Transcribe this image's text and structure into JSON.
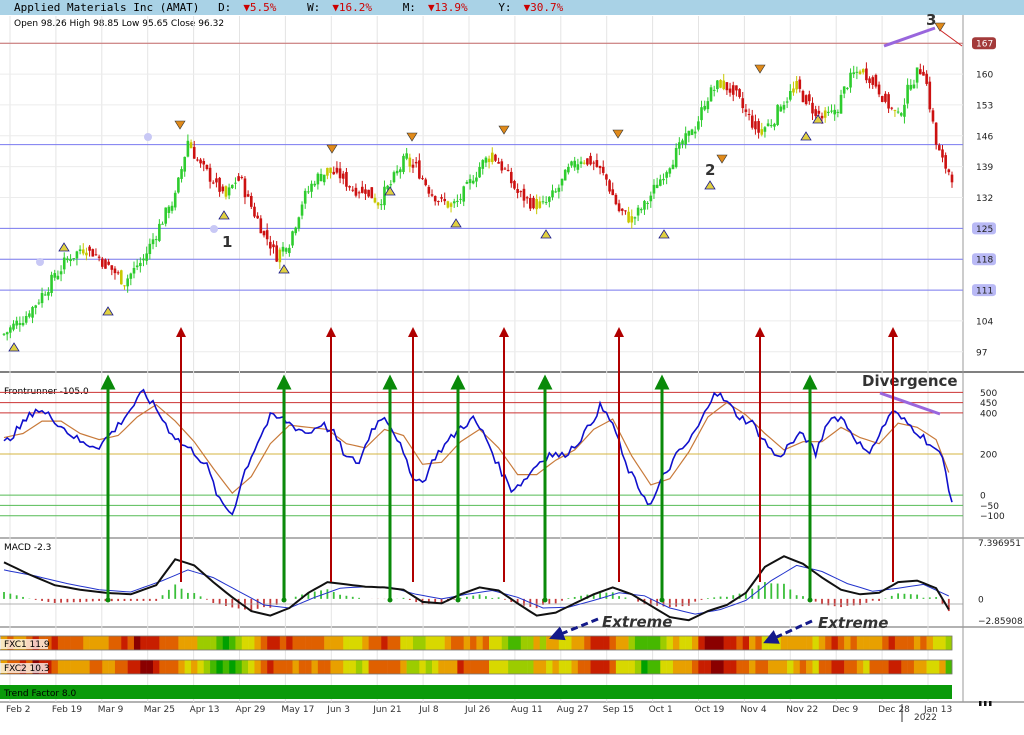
{
  "header": {
    "title": "Applied Materials Inc (AMAT)",
    "day_label": "D:",
    "day_value": "▼5.5%",
    "week_label": "W:",
    "week_value": "▼16.2%",
    "month_label": "M:",
    "month_value": "▼13.9%",
    "year_label": "Y:",
    "year_value": "▼30.7%",
    "ohlc": "Open 98.26  High 98.85  Low 95.65  Close 96.32"
  },
  "colors": {
    "up": "#2ecc2e",
    "down": "#cc1111",
    "neutral": "#c8c800",
    "hline": "#7a7af0",
    "frontrunner": "#1010cc",
    "signal": "#c87a3a",
    "green_arrow": "#0a8a0a",
    "red_arrow": "#b00000",
    "divergence": "#9966dd",
    "title_bg": "#a9d2e6"
  },
  "chart_data": {
    "type": "candlestick",
    "price_panel": {
      "y_ticks": [
        97,
        104,
        111,
        118,
        125,
        132,
        139,
        146,
        153,
        160,
        167
      ],
      "ylim": [
        94,
        170
      ],
      "highlighted_levels": [
        "111",
        "118",
        "125",
        "144",
        "167"
      ],
      "horizontal_levels": [
        111,
        118,
        125,
        144,
        167
      ],
      "wave_labels": [
        "1",
        "2",
        "3"
      ],
      "close_path": [
        [
          0,
          101
        ],
        [
          8,
          106
        ],
        [
          14,
          112
        ],
        [
          20,
          118
        ],
        [
          26,
          121
        ],
        [
          32,
          117
        ],
        [
          38,
          113
        ],
        [
          44,
          118
        ],
        [
          50,
          127
        ],
        [
          54,
          132
        ],
        [
          58,
          145
        ],
        [
          62,
          139
        ],
        [
          66,
          136
        ],
        [
          70,
          132
        ],
        [
          74,
          137
        ],
        [
          78,
          130
        ],
        [
          82,
          124
        ],
        [
          86,
          119
        ],
        [
          90,
          122
        ],
        [
          94,
          131
        ],
        [
          98,
          136
        ],
        [
          102,
          138
        ],
        [
          106,
          137
        ],
        [
          110,
          134
        ],
        [
          114,
          134
        ],
        [
          118,
          131
        ],
        [
          122,
          135
        ],
        [
          126,
          140
        ],
        [
          130,
          139
        ],
        [
          134,
          134
        ],
        [
          138,
          131
        ],
        [
          142,
          130
        ],
        [
          146,
          134
        ],
        [
          150,
          139
        ],
        [
          154,
          142
        ],
        [
          158,
          138
        ],
        [
          162,
          133
        ],
        [
          166,
          131
        ],
        [
          170,
          130
        ],
        [
          174,
          133
        ],
        [
          178,
          138
        ],
        [
          182,
          141
        ],
        [
          186,
          140
        ],
        [
          190,
          136
        ],
        [
          194,
          129
        ],
        [
          198,
          127
        ],
        [
          202,
          130
        ],
        [
          206,
          135
        ],
        [
          210,
          140
        ],
        [
          214,
          144
        ],
        [
          218,
          148
        ],
        [
          222,
          155
        ],
        [
          226,
          158
        ],
        [
          230,
          156
        ],
        [
          234,
          151
        ],
        [
          238,
          147
        ],
        [
          242,
          149
        ],
        [
          246,
          154
        ],
        [
          250,
          157
        ],
        [
          254,
          153
        ],
        [
          258,
          150
        ],
        [
          262,
          151
        ],
        [
          266,
          158
        ],
        [
          270,
          161
        ],
        [
          274,
          159
        ],
        [
          278,
          154
        ],
        [
          282,
          150
        ],
        [
          286,
          158
        ],
        [
          290,
          162
        ],
        [
          294,
          144
        ],
        [
          296,
          140
        ],
        [
          300,
          136
        ]
      ]
    },
    "frontrunner": {
      "label": "Frontrunner -105.0",
      "y_ticks": [
        "500",
        "450",
        "400",
        "200",
        "0",
        "−50",
        "−100"
      ],
      "tick_values": [
        500,
        450,
        400,
        200,
        0,
        -50,
        -100
      ],
      "ylim": [
        -150,
        560
      ],
      "annotation": "Divergence",
      "path": [
        [
          0,
          250
        ],
        [
          5,
          330
        ],
        [
          10,
          420
        ],
        [
          15,
          380
        ],
        [
          20,
          310
        ],
        [
          25,
          250
        ],
        [
          30,
          240
        ],
        [
          35,
          320
        ],
        [
          40,
          420
        ],
        [
          44,
          500
        ],
        [
          48,
          420
        ],
        [
          52,
          320
        ],
        [
          56,
          250
        ],
        [
          60,
          210
        ],
        [
          64,
          140
        ],
        [
          68,
          -30
        ],
        [
          72,
          -90
        ],
        [
          76,
          120
        ],
        [
          80,
          260
        ],
        [
          84,
          380
        ],
        [
          88,
          370
        ],
        [
          92,
          330
        ],
        [
          96,
          300
        ],
        [
          100,
          350
        ],
        [
          104,
          300
        ],
        [
          108,
          180
        ],
        [
          112,
          160
        ],
        [
          116,
          320
        ],
        [
          120,
          390
        ],
        [
          124,
          280
        ],
        [
          128,
          110
        ],
        [
          132,
          60
        ],
        [
          136,
          190
        ],
        [
          140,
          260
        ],
        [
          144,
          330
        ],
        [
          148,
          370
        ],
        [
          152,
          280
        ],
        [
          156,
          140
        ],
        [
          160,
          30
        ],
        [
          164,
          70
        ],
        [
          168,
          150
        ],
        [
          172,
          200
        ],
        [
          176,
          190
        ],
        [
          180,
          240
        ],
        [
          184,
          320
        ],
        [
          188,
          430
        ],
        [
          192,
          350
        ],
        [
          196,
          150
        ],
        [
          200,
          40
        ],
        [
          204,
          -50
        ],
        [
          208,
          90
        ],
        [
          212,
          190
        ],
        [
          216,
          260
        ],
        [
          220,
          360
        ],
        [
          224,
          510
        ],
        [
          228,
          450
        ],
        [
          232,
          380
        ],
        [
          236,
          350
        ],
        [
          240,
          260
        ],
        [
          244,
          180
        ],
        [
          248,
          250
        ],
        [
          252,
          300
        ],
        [
          256,
          200
        ],
        [
          260,
          370
        ],
        [
          264,
          380
        ],
        [
          268,
          290
        ],
        [
          272,
          200
        ],
        [
          276,
          290
        ],
        [
          280,
          410
        ],
        [
          284,
          360
        ],
        [
          288,
          310
        ],
        [
          292,
          250
        ],
        [
          296,
          180
        ],
        [
          300,
          -100
        ]
      ],
      "signal_path": [
        [
          0,
          280
        ],
        [
          6,
          300
        ],
        [
          12,
          360
        ],
        [
          18,
          360
        ],
        [
          24,
          300
        ],
        [
          30,
          270
        ],
        [
          36,
          290
        ],
        [
          42,
          380
        ],
        [
          48,
          440
        ],
        [
          54,
          360
        ],
        [
          60,
          260
        ],
        [
          66,
          130
        ],
        [
          72,
          10
        ],
        [
          78,
          90
        ],
        [
          84,
          250
        ],
        [
          90,
          340
        ],
        [
          96,
          330
        ],
        [
          102,
          320
        ],
        [
          108,
          250
        ],
        [
          114,
          230
        ],
        [
          120,
          320
        ],
        [
          126,
          290
        ],
        [
          132,
          150
        ],
        [
          138,
          160
        ],
        [
          144,
          260
        ],
        [
          150,
          320
        ],
        [
          156,
          230
        ],
        [
          162,
          100
        ],
        [
          168,
          100
        ],
        [
          174,
          170
        ],
        [
          180,
          220
        ],
        [
          186,
          320
        ],
        [
          192,
          370
        ],
        [
          198,
          190
        ],
        [
          204,
          50
        ],
        [
          210,
          80
        ],
        [
          216,
          210
        ],
        [
          222,
          380
        ],
        [
          228,
          450
        ],
        [
          234,
          390
        ],
        [
          240,
          300
        ],
        [
          246,
          220
        ],
        [
          252,
          260
        ],
        [
          258,
          260
        ],
        [
          264,
          330
        ],
        [
          270,
          280
        ],
        [
          276,
          250
        ],
        [
          282,
          350
        ],
        [
          288,
          330
        ],
        [
          294,
          270
        ],
        [
          300,
          30
        ]
      ]
    },
    "macd": {
      "label": "MACD -2.3",
      "y_ticks": [
        "7.396951",
        "0",
        "−2.85908"
      ],
      "tick_values": [
        7.396951,
        0,
        -2.85908
      ],
      "ylim": [
        -3.3,
        7.6
      ],
      "macd_path": [
        [
          0,
          4.8
        ],
        [
          8,
          3.2
        ],
        [
          16,
          1.8
        ],
        [
          24,
          1.2
        ],
        [
          32,
          0.8
        ],
        [
          40,
          0.6
        ],
        [
          48,
          1.8
        ],
        [
          54,
          5.2
        ],
        [
          60,
          4.4
        ],
        [
          66,
          2.2
        ],
        [
          72,
          0.2
        ],
        [
          78,
          -1.6
        ],
        [
          84,
          -2.2
        ],
        [
          90,
          -1.2
        ],
        [
          96,
          0.8
        ],
        [
          102,
          2.2
        ],
        [
          108,
          1.9
        ],
        [
          114,
          1.6
        ],
        [
          120,
          1.5
        ],
        [
          126,
          1.2
        ],
        [
          132,
          -0.4
        ],
        [
          138,
          -0.6
        ],
        [
          144,
          0.6
        ],
        [
          150,
          1.5
        ],
        [
          156,
          1.1
        ],
        [
          162,
          -0.6
        ],
        [
          168,
          -2.2
        ],
        [
          174,
          -1.8
        ],
        [
          180,
          -0.6
        ],
        [
          186,
          0.6
        ],
        [
          192,
          1.5
        ],
        [
          198,
          0.6
        ],
        [
          204,
          -0.9
        ],
        [
          210,
          -2.4
        ],
        [
          216,
          -2.8
        ],
        [
          222,
          -1.6
        ],
        [
          228,
          -0.8
        ],
        [
          234,
          0.8
        ],
        [
          240,
          4.2
        ],
        [
          246,
          5.6
        ],
        [
          252,
          4.6
        ],
        [
          258,
          2.8
        ],
        [
          264,
          1.2
        ],
        [
          270,
          0.6
        ],
        [
          276,
          0.8
        ],
        [
          282,
          2.2
        ],
        [
          288,
          2.4
        ],
        [
          294,
          1.4
        ],
        [
          300,
          -2.8
        ]
      ],
      "signal_path": [
        [
          0,
          3.8
        ],
        [
          10,
          3.0
        ],
        [
          20,
          2.0
        ],
        [
          30,
          1.2
        ],
        [
          40,
          0.9
        ],
        [
          50,
          2.4
        ],
        [
          58,
          3.8
        ],
        [
          66,
          2.8
        ],
        [
          74,
          1.0
        ],
        [
          82,
          -0.8
        ],
        [
          90,
          -1.2
        ],
        [
          98,
          0.2
        ],
        [
          106,
          1.4
        ],
        [
          114,
          1.6
        ],
        [
          122,
          1.5
        ],
        [
          130,
          0.6
        ],
        [
          138,
          0.0
        ],
        [
          146,
          0.6
        ],
        [
          154,
          1.1
        ],
        [
          162,
          0.2
        ],
        [
          170,
          -1.2
        ],
        [
          178,
          -1.1
        ],
        [
          186,
          -0.2
        ],
        [
          194,
          0.8
        ],
        [
          202,
          0.4
        ],
        [
          210,
          -1.2
        ],
        [
          218,
          -2.0
        ],
        [
          226,
          -1.4
        ],
        [
          234,
          -0.2
        ],
        [
          242,
          2.4
        ],
        [
          250,
          4.4
        ],
        [
          258,
          3.6
        ],
        [
          266,
          2.0
        ],
        [
          274,
          1.0
        ],
        [
          282,
          1.4
        ],
        [
          290,
          1.9
        ],
        [
          300,
          0.0
        ]
      ]
    },
    "fxc": [
      {
        "label": "FXC1 11.9",
        "annotation_left": "Extreme",
        "annotation_right": "Extreme"
      },
      {
        "label": "FXC2 10.3"
      }
    ],
    "trend_factor": {
      "label": "Trend Factor 8.0"
    },
    "x_axis": {
      "tick_labels": [
        "Feb 2",
        "Feb 19",
        "Mar 9",
        "Mar 25",
        "Apr 13",
        "Apr 29",
        "May 17",
        "Jun 3",
        "Jun 21",
        "Jul 8",
        "Jul 26",
        "Aug 11",
        "Aug 27",
        "Sep 15",
        "Oct 1",
        "Oct 19",
        "Nov 4",
        "Nov 22",
        "Dec 9",
        "Dec 28",
        "Jan 13"
      ],
      "year_label": "2022",
      "bar_count": 300
    }
  }
}
